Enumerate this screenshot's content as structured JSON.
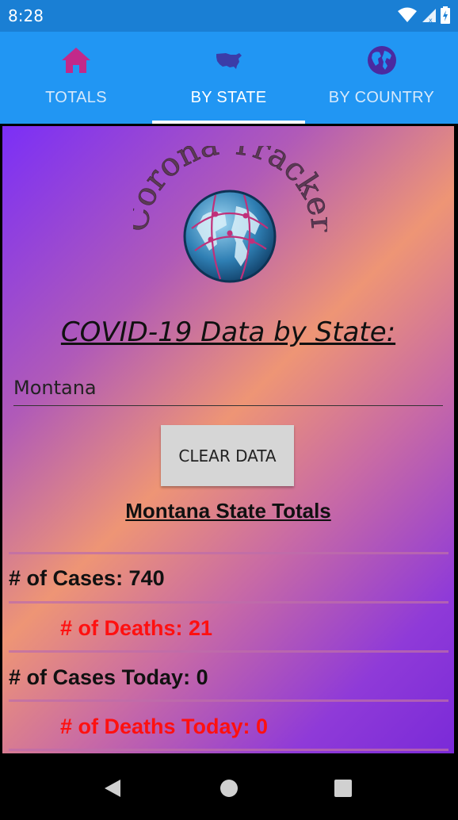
{
  "status_bar": {
    "time": "8:28"
  },
  "tabs": [
    {
      "label": "TOTALS",
      "icon": "home-icon",
      "icon_color": "#c2298a"
    },
    {
      "label": "BY STATE",
      "icon": "usa-map-icon",
      "icon_color": "#3b3ca8"
    },
    {
      "label": "BY COUNTRY",
      "icon": "globe-icon",
      "icon_color": "#4b2aa0"
    }
  ],
  "active_tab": "BY STATE",
  "logo": {
    "text": "Corona Tracker"
  },
  "page": {
    "title": "COVID-19 Data by State:",
    "state_input_value": "Montana",
    "clear_button_label": "CLEAR DATA",
    "totals_heading": "Montana State Totals"
  },
  "stats": {
    "cases": "# of Cases: 740",
    "deaths": "# of Deaths: 21",
    "cases_today": "# of Cases Today: 0",
    "deaths_today": "# of Deaths Today: 0"
  },
  "colors": {
    "tab_bar": "#2196f3",
    "status_bar": "#1a7fd4",
    "death_text": "#ff1010"
  }
}
